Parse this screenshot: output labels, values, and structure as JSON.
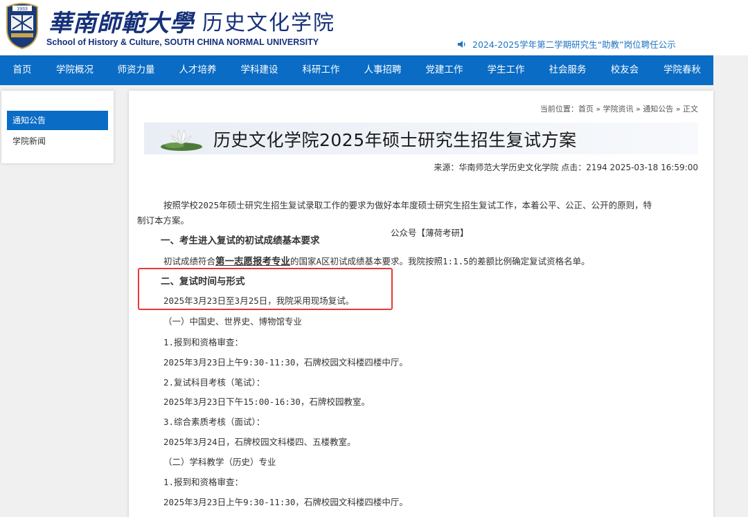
{
  "header": {
    "logo_year": "1933",
    "cn_university": "華南師範大學",
    "cn_department": "历史文化学院",
    "en_name": "School of History & Culture, SOUTH CHINA NORMAL UNIVERSITY",
    "announcement": "2024-2025学年第二学期研究生“助教”岗位聘任公示",
    "announcement_icon": "speaker-icon"
  },
  "nav": {
    "items": [
      "首页",
      "学院概况",
      "师资力量",
      "人才培养",
      "学科建设",
      "科研工作",
      "人事招聘",
      "党建工作",
      "学生工作",
      "社会服务",
      "校友会",
      "学院春秋"
    ]
  },
  "sidebar": {
    "items": [
      {
        "label": "通知公告",
        "active": true
      },
      {
        "label": "学院新闻",
        "active": false
      }
    ]
  },
  "article": {
    "breadcrumb": "当前位置：首页 » 学院资讯 » 通知公告 » 正文",
    "title": "历史文化学院2025年硕士研究生招生复试方案",
    "meta": "来源：华南师范大学历史文化学院 点击：2194 2025-03-18 16:59:00",
    "intro_1": "按照学校2025年硕士研究生招生复试录取工作的要求为做好本年度硕士研究生招生复试工作，本着公平、公正、公开的原则，特",
    "intro_2": "制订本方案。",
    "watermark": "公众号【薄荷考研】",
    "section1_heading": "一、考生进入复试的初试成绩基本要求",
    "section1_pre": "初试成绩符合",
    "section1_link": "第一志愿报考专业",
    "section1_post": "的国家A区初试成绩基本要求。我院按照1:1.5的差额比例确定复试资格名单。",
    "section2_heading": "二、复试时间与形式",
    "section2_text": "2025年3月23日至3月25日，我院采用现场复试。",
    "lines": [
      "（一）中国史、世界史、博物馆专业",
      "1.报到和资格审查：",
      "2025年3月23日上午9:30-11:30，石牌校园文科楼四楼中厅。",
      "2.复试科目考核（笔试）：",
      "2025年3月23日下午15:00-16:30，石牌校园教室。",
      "3.综合素质考核（面试）：",
      "2025年3月24日，石牌校园文科楼四、五楼教室。",
      "（二）学科教学（历史）专业",
      "1.报到和资格审查：",
      "2025年3月23日上午9:30-11:30，石牌校园文科楼四楼中厅。"
    ]
  },
  "colors": {
    "nav_bg": "#0a6cc4",
    "brand": "#15307a",
    "highlight_box": "#e53935",
    "announce": "#1e74c2"
  }
}
